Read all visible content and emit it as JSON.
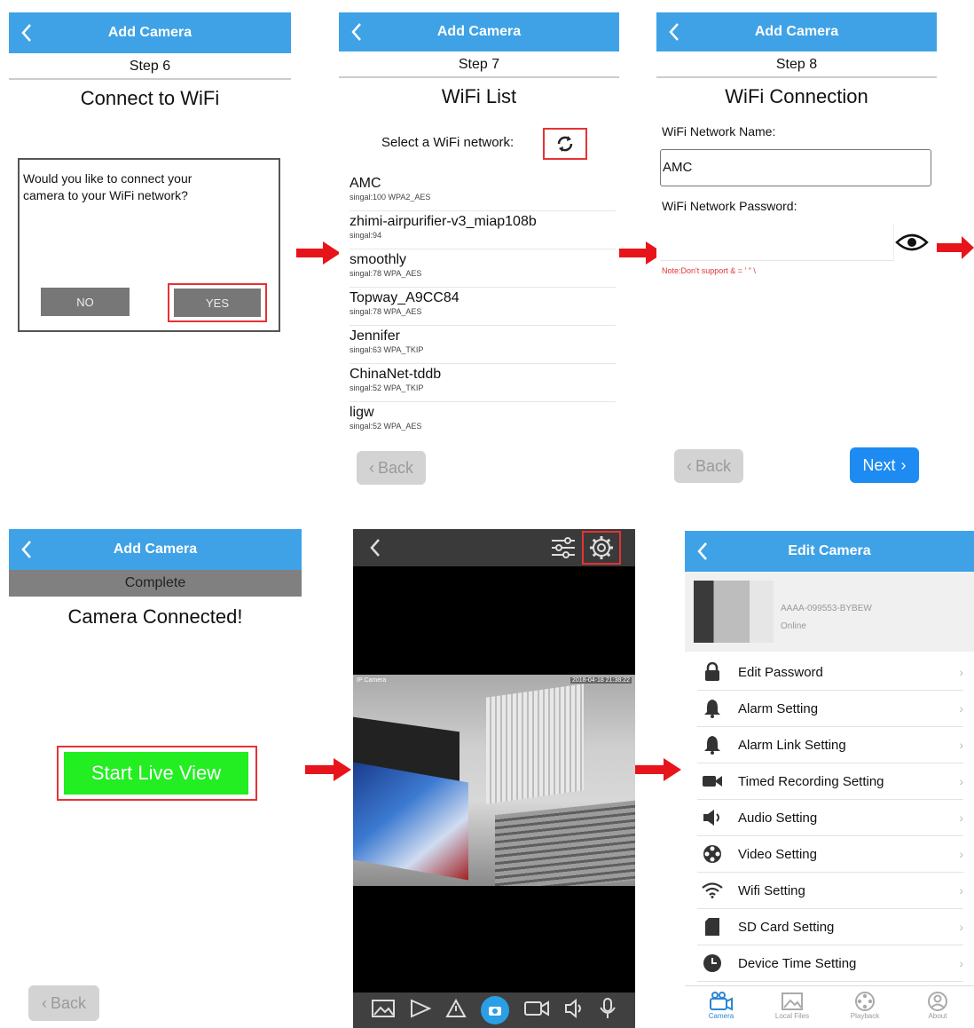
{
  "s6": {
    "nav_title": "Add Camera",
    "step": "Step 6",
    "title": "Connect to WiFi",
    "question": "Would you like to connect your camera to your WiFi network?",
    "no": "NO",
    "yes": "YES"
  },
  "s7": {
    "nav_title": "Add Camera",
    "step": "Step 7",
    "title": "WiFi List",
    "select_label": "Select a WiFi network:",
    "back": "Back",
    "networks": [
      {
        "name": "AMC",
        "detail": "singal:100    WPA2_AES"
      },
      {
        "name": "zhimi-airpurifier-v3_miap108b",
        "detail": "singal:94"
      },
      {
        "name": "smoothly",
        "detail": "singal:78    WPA_AES"
      },
      {
        "name": "Topway_A9CC84",
        "detail": "singal:78    WPA_AES"
      },
      {
        "name": "Jennifer",
        "detail": "singal:63    WPA_TKIP"
      },
      {
        "name": "ChinaNet-tddb",
        "detail": "singal:52    WPA_TKIP"
      },
      {
        "name": "ligw",
        "detail": "singal:52    WPA_AES"
      }
    ]
  },
  "s8": {
    "nav_title": "Add Camera",
    "step": "Step 8",
    "title": "WiFi Connection",
    "name_label": "WiFi Network Name:",
    "name_value": "AMC",
    "pw_label": "WiFi Network Password:",
    "pw_value": "",
    "note": "Note:Don't support & = ' \" \\",
    "back": "Back",
    "next": "Next"
  },
  "complete": {
    "nav_title": "Add Camera",
    "status": "Complete",
    "title": "Camera Connected!",
    "start": "Start Live View",
    "back": "Back"
  },
  "live": {
    "overlay_left": "IP Camera",
    "overlay_right": "2018-04-18 21:38:22"
  },
  "edit": {
    "nav_title": "Edit Camera",
    "camera_id": "AAAA-099553-BYBEW",
    "camera_status": "Online",
    "items": [
      {
        "label": "Edit Password",
        "icon": "lock-icon"
      },
      {
        "label": "Alarm Setting",
        "icon": "bell-icon"
      },
      {
        "label": "Alarm Link Setting",
        "icon": "bell-icon"
      },
      {
        "label": "Timed Recording Setting",
        "icon": "video-camera-icon"
      },
      {
        "label": "Audio Setting",
        "icon": "speaker-icon"
      },
      {
        "label": "Video Setting",
        "icon": "film-reel-icon"
      },
      {
        "label": "Wifi Setting",
        "icon": "wifi-icon"
      },
      {
        "label": "SD Card Setting",
        "icon": "sd-card-icon"
      },
      {
        "label": "Device Time Setting",
        "icon": "clock-icon"
      }
    ],
    "tabs": [
      "Camera",
      "Local Files",
      "Playback",
      "About"
    ]
  },
  "colors": {
    "nav_blue": "#3fa2e6",
    "highlight_red": "#e53333",
    "arrow_red": "#e8141b",
    "start_green": "#22ee22",
    "next_blue": "#1d8bf1"
  }
}
